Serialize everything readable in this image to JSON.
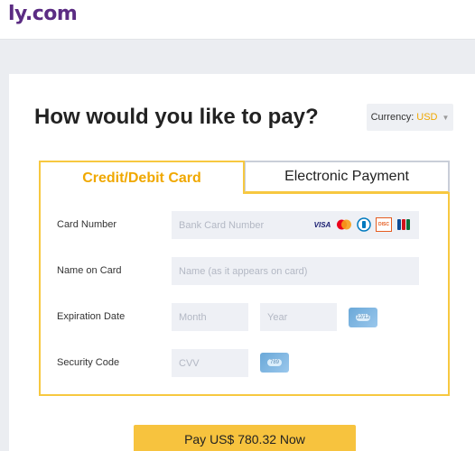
{
  "header": {
    "logo_text": "ly.com"
  },
  "page": {
    "title": "How would you like to pay?"
  },
  "currency": {
    "label": "Currency:",
    "value": "USD"
  },
  "tabs": [
    {
      "label": "Credit/Debit Card",
      "active": true
    },
    {
      "label": "Electronic Payment",
      "active": false
    }
  ],
  "form": {
    "card_number": {
      "label": "Card Number",
      "placeholder": "Bank Card Number"
    },
    "name_on_card": {
      "label": "Name on Card",
      "placeholder": "Name (as it appears on card)"
    },
    "expiration": {
      "label": "Expiration Date",
      "month_placeholder": "Month",
      "year_placeholder": "Year",
      "hint_text": "12/12"
    },
    "security": {
      "label": "Security Code",
      "placeholder": "CVV",
      "hint_text": "789"
    }
  },
  "brands": [
    {
      "name": "visa-icon",
      "text": "VISA",
      "color": "#1a1f71"
    },
    {
      "name": "mastercard-icon",
      "text": "",
      "color": "#eb001b"
    },
    {
      "name": "diners-icon",
      "text": "D",
      "color": "#0079be"
    },
    {
      "name": "discover-icon",
      "text": "DISC",
      "color": "#e55c20"
    },
    {
      "name": "jcb-icon",
      "text": "JCB",
      "color": "#0b6e3a"
    }
  ],
  "pay_button": {
    "label": "Pay US$ 780.32 Now"
  },
  "colors": {
    "accent": "#f7c840",
    "brand": "#5b2c83"
  }
}
